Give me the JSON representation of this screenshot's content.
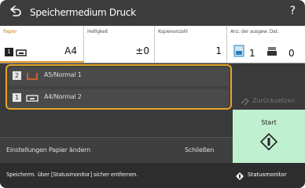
{
  "header": {
    "title": "Speichermedium Druck",
    "back_icon": "back-arrow-icon",
    "help_label": "?"
  },
  "settings": {
    "paper": {
      "label": "Papier",
      "value": "A4"
    },
    "density": {
      "label": "Helligkeit",
      "value": "±0"
    },
    "copies": {
      "label": "Kopienanzahl",
      "value": "1"
    },
    "originals": {
      "label": "Anz. der ausgew. Dat.",
      "count_a": "1",
      "count_b": "0"
    }
  },
  "paper_sources": [
    {
      "slot": "2",
      "label": "A5/Normal 1"
    },
    {
      "slot": "1",
      "label": "A4/Normal 2"
    }
  ],
  "actions": {
    "reset_label": "Zurücksetzen",
    "start_label": "Start",
    "change_paper_label": "Einstellungen Papier ändern",
    "close_label": "Schließen"
  },
  "statusbar": {
    "message": "Speicherm. über [Statusmonitor] sicher entfernen.",
    "status_monitor_label": "Statusmonitor"
  },
  "colors": {
    "accent": "#e8a526",
    "start_bg": "#bff0d0",
    "header_bg": "#3c3c3c"
  }
}
